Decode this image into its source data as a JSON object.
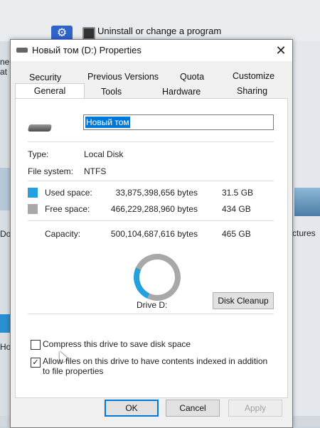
{
  "background": {
    "uninstall_label": "Uninstall or change a program",
    "left_fragments": [
      "ne",
      "at",
      "Do",
      "Нов"
    ],
    "right_fragment": "ctures"
  },
  "dialog": {
    "title": "Новый том (D:) Properties",
    "tabs_row1": [
      "Security",
      "Previous Versions",
      "Quota",
      "Customize"
    ],
    "tabs_row2": [
      "General",
      "Tools",
      "Hardware",
      "Sharing"
    ],
    "active_tab": "General",
    "volume_name": "Новый том",
    "type_label": "Type:",
    "type_value": "Local Disk",
    "fs_label": "File system:",
    "fs_value": "NTFS",
    "used_label": "Used space:",
    "used_bytes": "33,875,398,656 bytes",
    "used_size": "31.5 GB",
    "free_label": "Free space:",
    "free_bytes": "466,229,288,960 bytes",
    "free_size": "434 GB",
    "capacity_label": "Capacity:",
    "capacity_bytes": "500,104,687,616 bytes",
    "capacity_size": "465 GB",
    "drive_label": "Drive D:",
    "disk_cleanup": "Disk Cleanup",
    "compress_label": "Compress this drive to save disk space",
    "compress_checked": false,
    "index_label": "Allow files on this drive to have contents indexed in addition to file properties",
    "index_checked": true,
    "ok": "OK",
    "cancel": "Cancel",
    "apply": "Apply",
    "used_fraction": 0.068,
    "colors": {
      "used": "#26a0da",
      "free": "#a8a8a8"
    }
  }
}
